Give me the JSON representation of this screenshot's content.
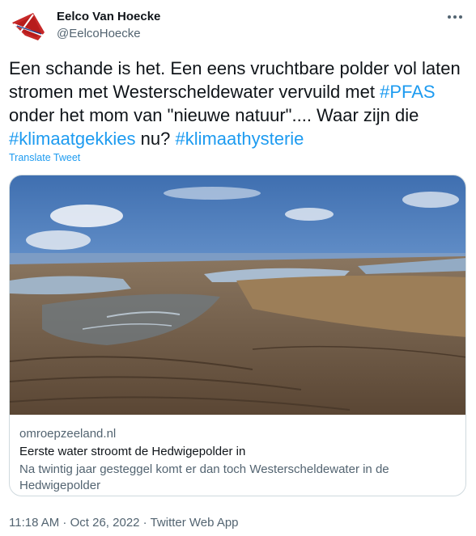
{
  "author": {
    "name": "Eelco Van Hoecke",
    "handle": "@EelcoHoecke"
  },
  "tweet": {
    "text_1": "Een schande is het. Een eens vruchtbare polder vol laten stromen met Westerscheldewater vervuild met ",
    "hashtag_1": "#PFAS",
    "text_2": " onder het mom van \"nieuwe natuur\".... Waar zijn die ",
    "hashtag_2": "#klimaatgekkies",
    "text_3": " nu? ",
    "hashtag_3": "#klimaathysterie",
    "translate_label": "Translate Tweet"
  },
  "card": {
    "domain": "omroepzeeland.nl",
    "title": "Eerste water stroomt de Hedwigepolder in",
    "description": "Na twintig jaar gesteggel komt er dan toch Westerscheldewater in de Hedwigepolder"
  },
  "footer": {
    "time": "11:18 AM",
    "sep1": " · ",
    "date": "Oct 26, 2022",
    "sep2": " · ",
    "source": "Twitter Web App"
  },
  "colors": {
    "link": "#1d9bf0",
    "muted": "#536471",
    "text": "#0f1419"
  },
  "icons": {
    "avatar": "flag-avatar",
    "more": "more-horizontal-icon"
  }
}
